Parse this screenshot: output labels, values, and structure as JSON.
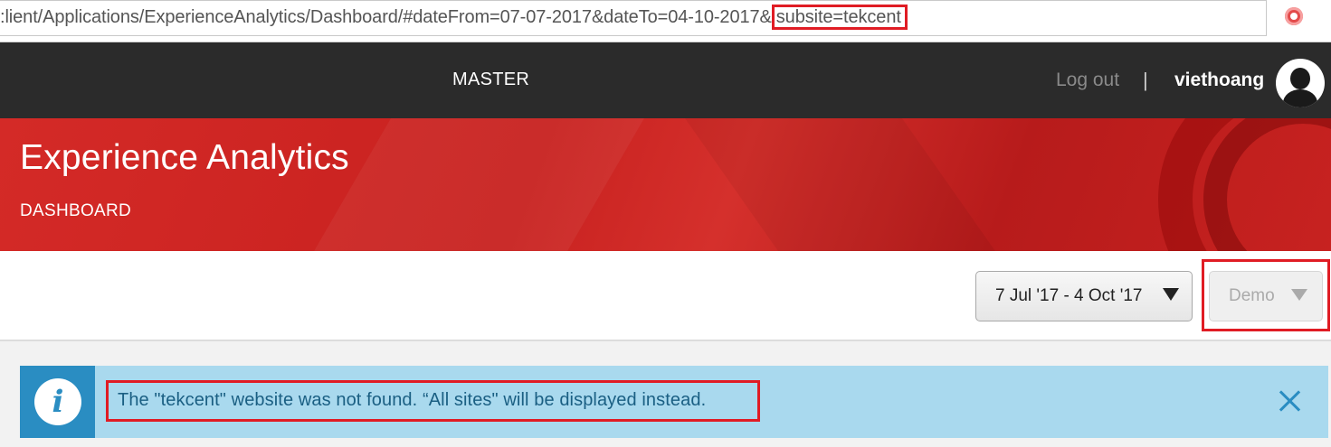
{
  "browser": {
    "url_prefix": ":lient/Applications/ExperienceAnalytics/Dashboard/#dateFrom=07-07-2017&dateTo=04-10-2017&",
    "url_highlight": "subsite=tekcent",
    "extension_icon": "opera-style-red-icon"
  },
  "nav": {
    "site_name": "MASTER",
    "logout_label": "Log out",
    "separator": "|",
    "username": "viethoang",
    "avatar_icon": "user-avatar-icon"
  },
  "banner": {
    "title": "Experience Analytics",
    "subtitle": "DASHBOARD"
  },
  "toolbar": {
    "date_range": "7 Jul '17 - 4 Oct '17",
    "site_selector": "Demo"
  },
  "alert": {
    "icon": "info-icon",
    "message": "The \"tekcent\" website was not found. “All sites\" will be displayed instead.",
    "close_icon": "close-icon"
  },
  "colors": {
    "nav_bg": "#2b2b2b",
    "banner_red": "#c8211f",
    "highlight_red": "#e01c24",
    "info_bg": "#a9d9ee",
    "info_icon_bg": "#2a8dc2",
    "info_text": "#1a5f83"
  }
}
